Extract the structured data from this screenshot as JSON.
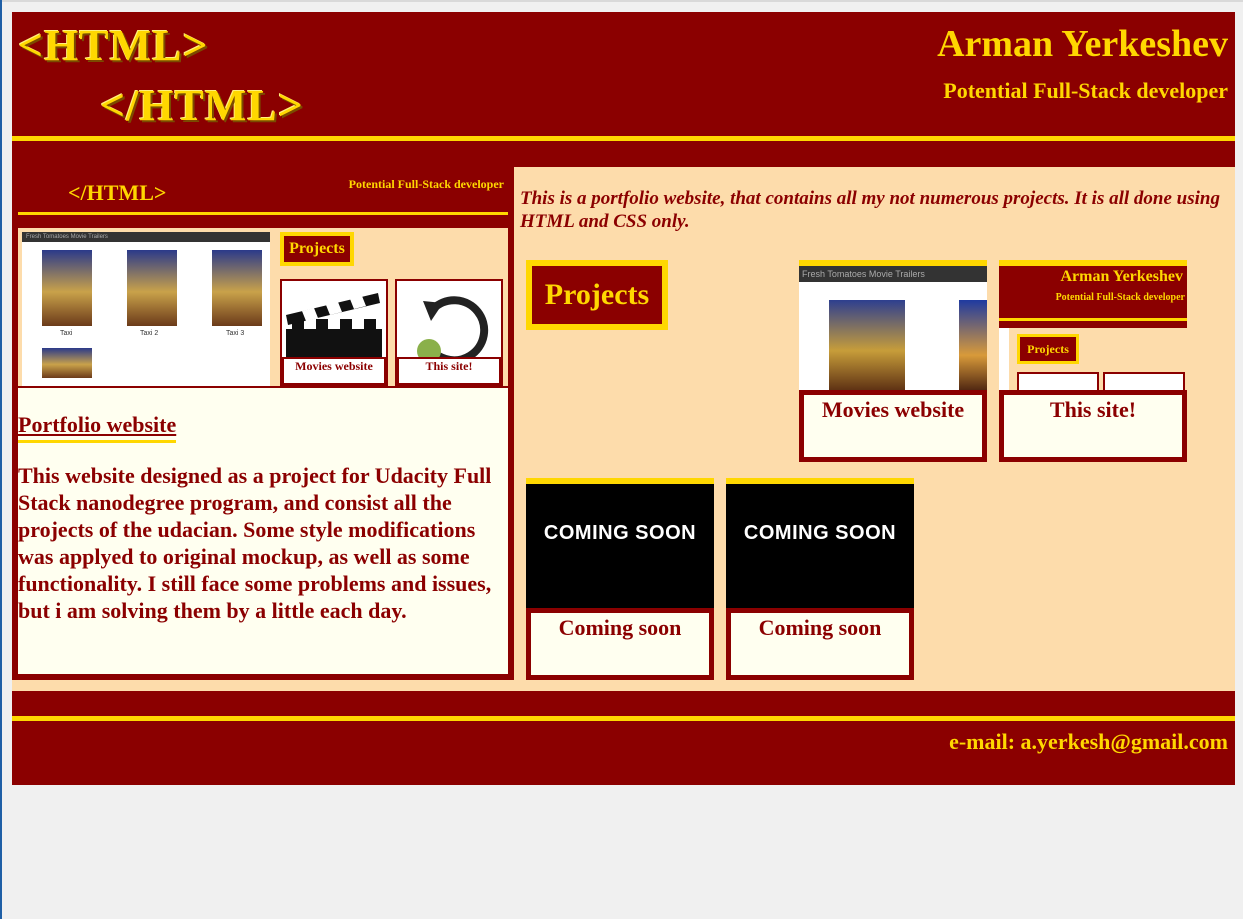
{
  "header": {
    "logo_open": "<HTML>",
    "logo_close": "</HTML>",
    "name": "Arman Yerkeshev",
    "role": "Potential Full-Stack developer"
  },
  "preview": {
    "logo": "</HTML>",
    "role": "Potential Full-Stack developer",
    "shot_bar": "Fresh Tomatoes Movie Trailers",
    "posters": [
      "Taxi",
      "Taxi 2",
      "Taxi 3"
    ],
    "projects_label": "Projects",
    "tiles": [
      "Movies website",
      "This site!"
    ]
  },
  "description": {
    "title": "Portfolio website",
    "body": "This website designed as a project for Udacity Full Stack nanodegree program, and consist all the projects of the udacian. Some style modifications was applyed to original mockup, as well as some functionality. I still face some problems and issues, but i am solving them by a little each day."
  },
  "intro": "This is a portfolio website, that contains all my not numerous projects. It is all done using HTML and CSS only.",
  "projects_heading": "Projects",
  "cards": [
    {
      "caption": "Movies website"
    },
    {
      "caption": "This site!",
      "thumb_name": "Arman Yerkeshev",
      "thumb_role": "Potential Full-Stack developer",
      "thumb_projects": "Projects"
    },
    {
      "caption": "Coming soon",
      "image_text": "COMING SOON"
    },
    {
      "caption": "Coming soon",
      "image_text": "COMING SOON"
    }
  ],
  "movies_thumb_bar": "Fresh Tomatoes Movie Trailers",
  "footer": {
    "email": "e-mail: a.yerkesh@gmail.com"
  },
  "colors": {
    "maroon": "#8b0000",
    "gold": "#ffd700",
    "peach": "#fddcab",
    "ivory": "#fffff0"
  }
}
